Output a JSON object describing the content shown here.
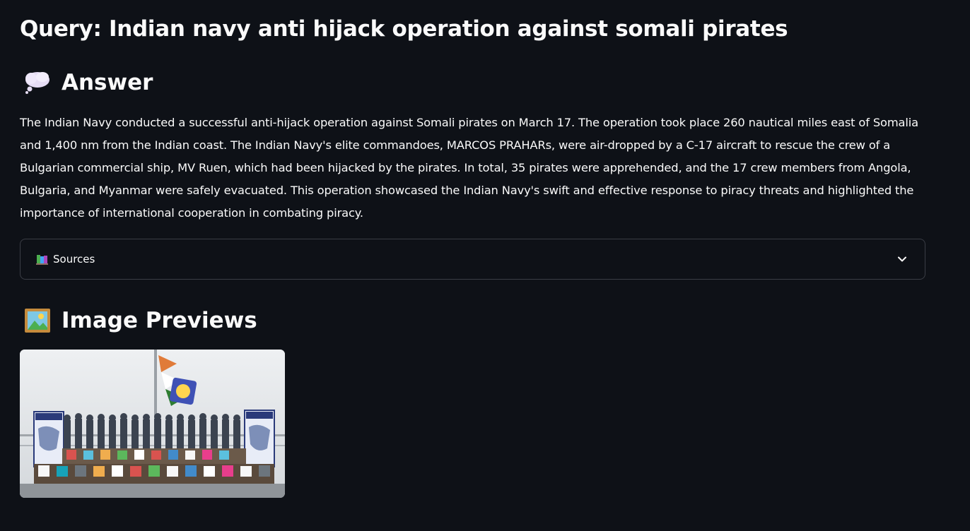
{
  "query": {
    "title": "Query: Indian navy anti hijack operation against somali pirates"
  },
  "answer": {
    "icon": "thought-balloon-icon",
    "heading": "Answer",
    "text": "The Indian Navy conducted a successful anti-hijack operation against Somali pirates on March 17. The operation took place 260 nautical miles east of Somalia and 1,400 nm from the Indian coast. The Indian Navy's elite commandoes, MARCOS PRAHARs, were air-dropped by a C-17 aircraft to rescue the crew of a Bulgarian commercial ship, MV Ruen, which had been hijacked by the pirates. In total, 35 pirates were apprehended, and the 17 crew members from Angola, Bulgaria, and Myanmar were safely evacuated. This operation showcased the Indian Navy's swift and effective response to piracy threats and highlighted the importance of international cooperation in combating piracy."
  },
  "sources": {
    "icon": "books-icon",
    "label": "Sources",
    "expanded": false
  },
  "previews": {
    "icon": "framed-picture-icon",
    "heading": "Image Previews",
    "images": [
      {
        "name": "preview-image-navy-pirates"
      }
    ]
  },
  "colors": {
    "background": "#0e1117",
    "text": "#fafafa",
    "border": "#3a3d45"
  }
}
